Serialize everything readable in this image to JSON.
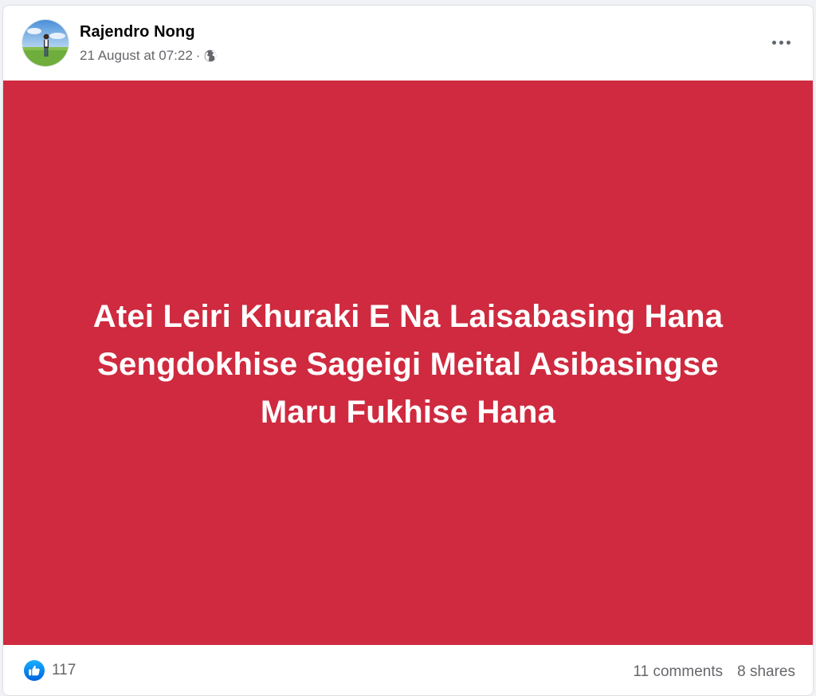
{
  "post": {
    "author": "Rajendro Nong",
    "timestamp": "21 August at 07:22",
    "separator": "·",
    "audience_icon": "globe-icon",
    "more_icon": "more-options-icon",
    "text_lines": [
      "Atei Leiri Khuraki E Na Laisabasing Hana",
      "Sengdokhise Sageigi Meital Asibasingse",
      "Maru Fukhise Hana"
    ],
    "background_color": "#cf2a3f",
    "text_color": "#ffffff"
  },
  "footer": {
    "reaction_icon": "like-icon",
    "reaction_count": "117",
    "comments": "11 comments",
    "shares": "8 shares",
    "accent_color": "#1877f2"
  }
}
